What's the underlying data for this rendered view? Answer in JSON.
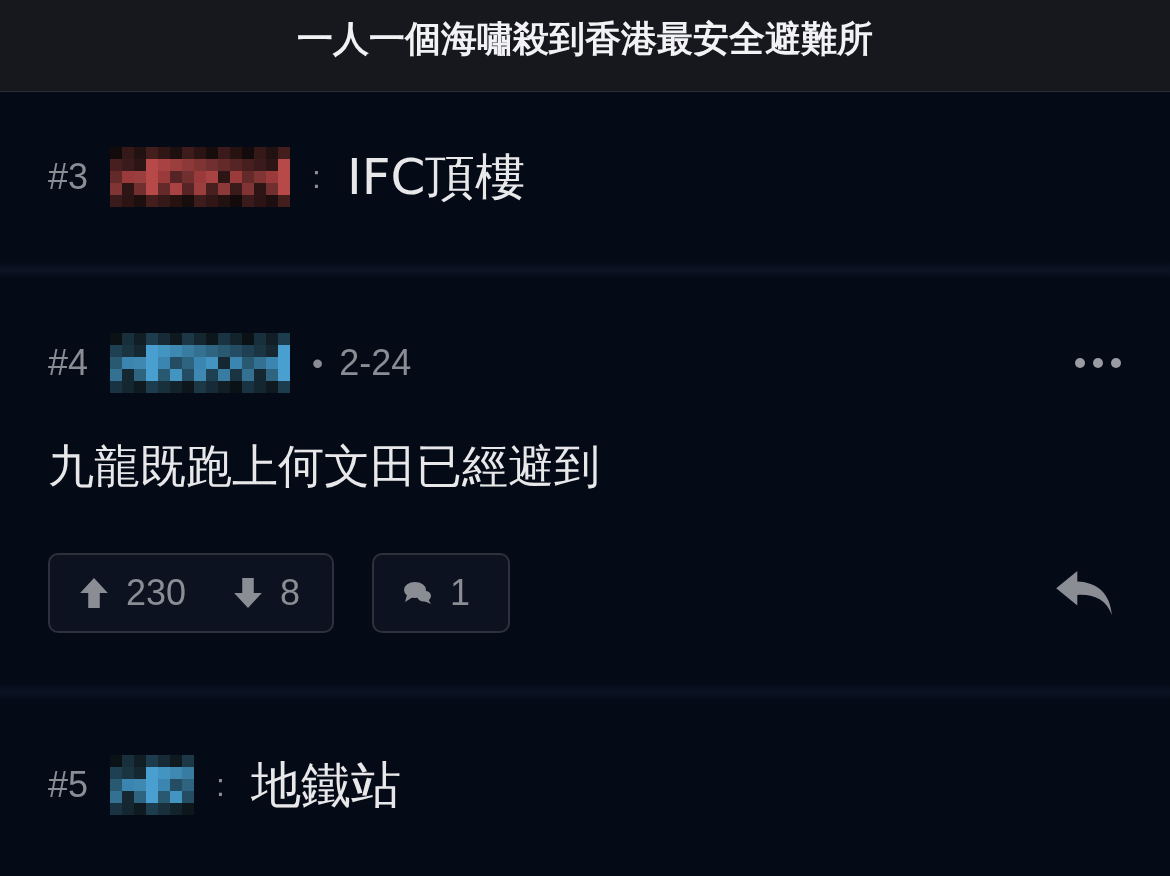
{
  "header": {
    "title": "一人一個海嘯殺到香港最安全避難所"
  },
  "posts": [
    {
      "kind": "compact",
      "number": "#3",
      "color": "#9a3a3a",
      "separator": ":",
      "text": "IFC頂樓"
    },
    {
      "kind": "full",
      "number": "#4",
      "color": "#3a86b0",
      "separator": "•",
      "date": "2-24",
      "text": "九龍既跑上何文田已經避到",
      "upvotes": "230",
      "downvotes": "8",
      "replies": "1"
    },
    {
      "kind": "compact",
      "number": "#5",
      "color": "#3a86b0",
      "separator": ":",
      "text": "地鐵站"
    }
  ]
}
